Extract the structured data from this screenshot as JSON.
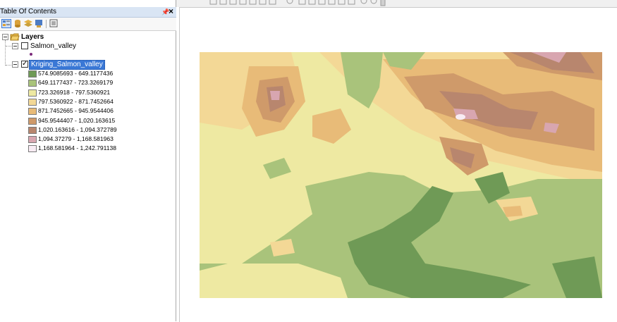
{
  "toc": {
    "title": "Table Of Contents",
    "pin_icon": "\u0004",
    "close_icon": "×",
    "root": {
      "label": "Layers"
    },
    "layers": [
      {
        "name": "Salmon_valley",
        "checked": false
      },
      {
        "name": "Kriging_Salmon_valley",
        "checked": true,
        "selected": true
      }
    ],
    "legend": [
      {
        "label": "574.9085693 - 649.1177436",
        "color": "#6f9a56"
      },
      {
        "label": "649.1177437 - 723.3269179",
        "color": "#a9c37b"
      },
      {
        "label": "723.326918 - 797.5360921",
        "color": "#eee9a2"
      },
      {
        "label": "797.5360922 - 871.7452664",
        "color": "#f3d896"
      },
      {
        "label": "871.7452665 - 945.9544406",
        "color": "#e8bb78"
      },
      {
        "label": "945.9544407 - 1,020.163615",
        "color": "#cf9a6a"
      },
      {
        "label": "1,020.163616 - 1,094.372789",
        "color": "#b8866e"
      },
      {
        "label": "1,094.37279 - 1,168.581963",
        "color": "#d8a6b0"
      },
      {
        "label": "1,168.581964 - 1,242.791138",
        "color": "#f8ecf4"
      }
    ]
  },
  "icons": {
    "list_by_drawing_order": "list-by-drawing-order-icon",
    "list_by_source": "list-by-source-icon",
    "list_by_visibility": "list-by-visibility-icon",
    "list_by_selection": "list-by-selection-icon",
    "options": "options-icon",
    "layers_folder": "layers-folder-icon",
    "point_symbol": "point-symbol-icon"
  }
}
